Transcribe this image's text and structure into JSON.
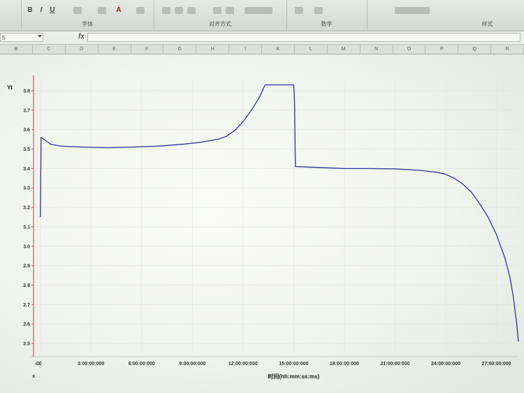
{
  "ribbon": {
    "groups": [
      {
        "label": "字体"
      },
      {
        "label": "对齐方式"
      },
      {
        "label": "数字"
      },
      {
        "label": "样式"
      }
    ],
    "buttons": {
      "bold": "B",
      "italic": "I",
      "underline": "U",
      "font_color": "A"
    }
  },
  "formula_bar": {
    "name_box": "5",
    "fx": "fx"
  },
  "columns": [
    "B",
    "C",
    "D",
    "E",
    "F",
    "G",
    "H",
    "I",
    "K",
    "L",
    "M",
    "N",
    "O",
    "P",
    "Q",
    "R"
  ],
  "chart_data": {
    "type": "line",
    "title": "",
    "xlabel": "时间(hh:mm:ss:ms)",
    "ylabel": "Yt",
    "x_axis_marker": "x",
    "ylim": [
      2.45,
      3.85
    ],
    "y_ticks": [
      "3.8",
      "3.7",
      "3.6",
      "3.5",
      "3.4",
      "3.3",
      "3.2",
      "3.1",
      "3.0",
      "2.9",
      "2.8",
      "2.7",
      "2.6",
      "2.5"
    ],
    "xlim_hours": [
      -0.4,
      28.3
    ],
    "x_ticks": [
      {
        "hours": -0.2,
        "label": "-0"
      },
      {
        "hours": 0,
        "label": "0"
      },
      {
        "hours": 3,
        "label": "3:00:00:000"
      },
      {
        "hours": 6,
        "label": "6:00:00:000"
      },
      {
        "hours": 9,
        "label": "9:00:00:000"
      },
      {
        "hours": 12,
        "label": "12:00:00:000"
      },
      {
        "hours": 15,
        "label": "15:00:00:000"
      },
      {
        "hours": 18,
        "label": "18:00:00:000"
      },
      {
        "hours": 21,
        "label": "21:00:00:000"
      },
      {
        "hours": 24,
        "label": "24:00:00:000"
      },
      {
        "hours": 27,
        "label": "27:00:00:000"
      }
    ],
    "grid": true,
    "series": [
      {
        "color": "#3a3e9c",
        "points": [
          [
            0.0,
            3.15
          ],
          [
            0.05,
            3.56
          ],
          [
            0.3,
            3.545
          ],
          [
            0.6,
            3.525
          ],
          [
            1.2,
            3.515
          ],
          [
            2.5,
            3.51
          ],
          [
            4.0,
            3.507
          ],
          [
            5.5,
            3.51
          ],
          [
            7.0,
            3.515
          ],
          [
            8.5,
            3.525
          ],
          [
            9.5,
            3.535
          ],
          [
            10.5,
            3.55
          ],
          [
            11.0,
            3.565
          ],
          [
            11.5,
            3.595
          ],
          [
            12.0,
            3.64
          ],
          [
            12.5,
            3.7
          ],
          [
            13.0,
            3.77
          ],
          [
            13.3,
            3.83
          ],
          [
            15.0,
            3.83
          ],
          [
            15.05,
            3.74
          ],
          [
            15.1,
            3.41
          ],
          [
            16.5,
            3.405
          ],
          [
            18.0,
            3.4
          ],
          [
            19.5,
            3.4
          ],
          [
            21.0,
            3.398
          ],
          [
            22.5,
            3.39
          ],
          [
            23.5,
            3.38
          ],
          [
            24.0,
            3.37
          ],
          [
            24.5,
            3.35
          ],
          [
            25.0,
            3.32
          ],
          [
            25.5,
            3.28
          ],
          [
            26.0,
            3.22
          ],
          [
            26.5,
            3.15
          ],
          [
            27.0,
            3.06
          ],
          [
            27.5,
            2.94
          ],
          [
            27.8,
            2.84
          ],
          [
            28.0,
            2.74
          ],
          [
            28.2,
            2.6
          ],
          [
            28.3,
            2.51
          ]
        ]
      }
    ]
  }
}
